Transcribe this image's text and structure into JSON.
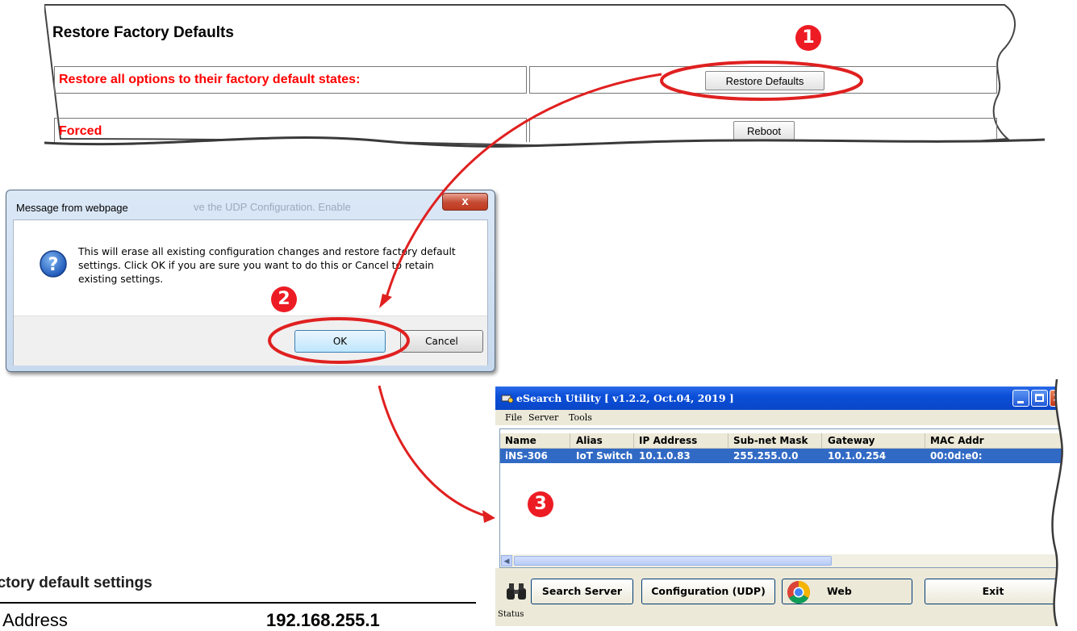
{
  "web_panel": {
    "title": "Restore Factory Defaults",
    "restore_label": "Restore all options to their factory default states:",
    "restore_button": "Restore Defaults",
    "row2_label_partial": "Forced",
    "reboot_button": "Reboot"
  },
  "dialog": {
    "title": "Message from webpage",
    "background_text": "ve the UDP Configuration. Enable",
    "close_glyph": "x",
    "message": "This will erase all existing configuration changes and restore factory default settings. Click OK if you are sure you want to do this or Cancel to retain existing settings.",
    "icon": "question-icon",
    "ok_button": "OK",
    "cancel_button": "Cancel"
  },
  "esearch": {
    "title": "eSearch Utility [ v1.2.2, Oct.04, 2019 ]",
    "menu": [
      "File",
      "Server",
      "Tools"
    ],
    "columns": [
      "Name",
      "Alias",
      "IP Address",
      "Sub-net Mask",
      "Gateway",
      "MAC Addr"
    ],
    "rows": [
      {
        "name": "iNS-306",
        "alias": "IoT Switch",
        "ip": "10.1.0.83",
        "mask": "255.255.0.0",
        "gateway": "10.1.0.254",
        "mac": "00:0d:e0:"
      }
    ],
    "buttons": {
      "search": "Search Server",
      "config": "Configuration (UDP)",
      "web": "Web",
      "exit": "Exit"
    },
    "status": "Status",
    "selected_row_color": "#316ac5",
    "title_bar_color": "#0b4fd8"
  },
  "factory_defaults": {
    "title": "actory default settings",
    "label": "P Address",
    "value": "192.168.255.1"
  },
  "steps": [
    "1",
    "2",
    "3"
  ],
  "annotation_color": "#ed1c24"
}
